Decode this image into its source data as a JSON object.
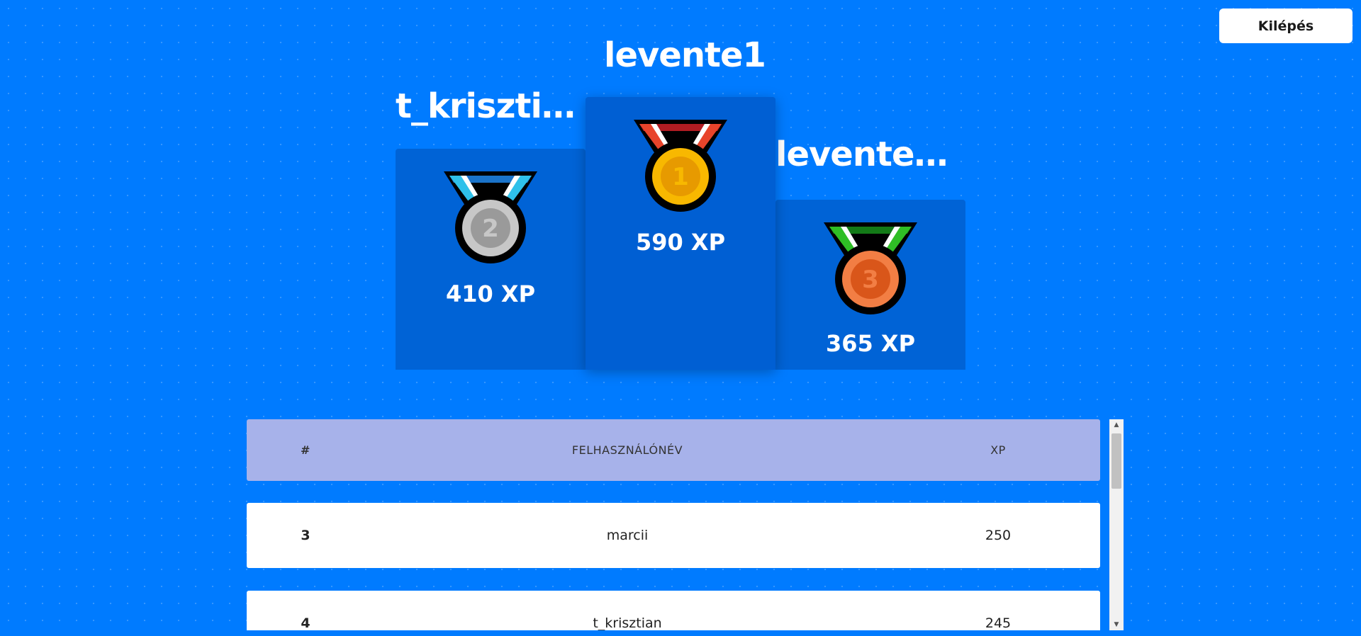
{
  "header": {
    "logout_label": "Kilépés"
  },
  "podium": {
    "first": {
      "name": "levente1",
      "xp_label": "590 XP",
      "rank": 1
    },
    "second": {
      "name": "t_kriszti…",
      "xp_label": "410 XP",
      "rank": 2
    },
    "third": {
      "name": "levente…",
      "xp_label": "365 XP",
      "rank": 3
    }
  },
  "medals": {
    "gold": {
      "icon": "gold-medal-icon",
      "ribbon": "#e8442b",
      "ribbon_dark": "#b01c22",
      "disc": "#f8b800",
      "digit": "1"
    },
    "silver": {
      "icon": "silver-medal-icon",
      "ribbon": "#2fc1ea",
      "ribbon_dark": "#1a73c9",
      "disc": "#c7c7c7",
      "digit": "2"
    },
    "bronze": {
      "icon": "bronze-medal-icon",
      "ribbon": "#2fbe25",
      "ribbon_dark": "#137a17",
      "disc": "#f27e44",
      "digit": "3"
    }
  },
  "table": {
    "headers": {
      "rank": "#",
      "username": "FELHASZNÁLÓNÉV",
      "xp": "XP"
    },
    "rows": [
      {
        "rank": "3",
        "username": "marcii",
        "xp": "250"
      },
      {
        "rank": "4",
        "username": "t_krisztian",
        "xp": "245"
      }
    ]
  },
  "colors": {
    "background": "#007bff",
    "podium": "#0063d6",
    "table_header": "#a7b2ea"
  }
}
